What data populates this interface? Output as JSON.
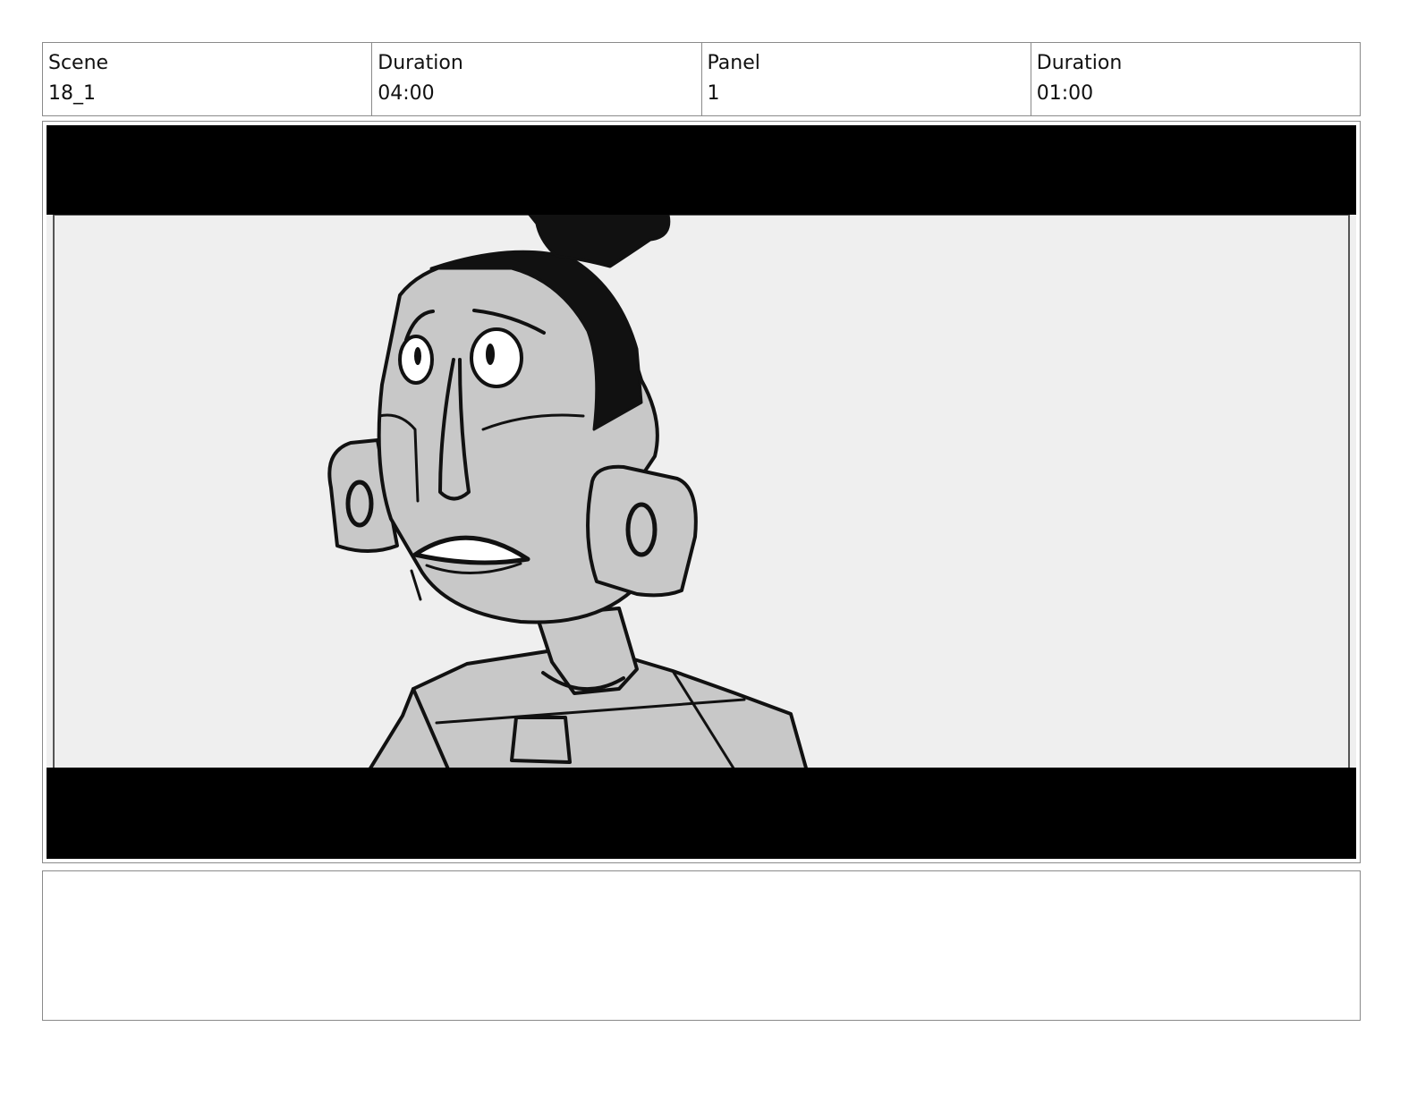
{
  "header": {
    "scene_label": "Scene",
    "scene_value": "18_1",
    "scene_duration_label": "Duration",
    "scene_duration_value": "04:00",
    "panel_label": "Panel",
    "panel_value": "1",
    "panel_duration_label": "Duration",
    "panel_duration_value": "01:00"
  },
  "panel": {
    "letterbox_color": "#000000",
    "background_color": "#efefef",
    "character_fill": "#c8c8c8",
    "line_color": "#111111"
  },
  "notes": {
    "text": ""
  }
}
